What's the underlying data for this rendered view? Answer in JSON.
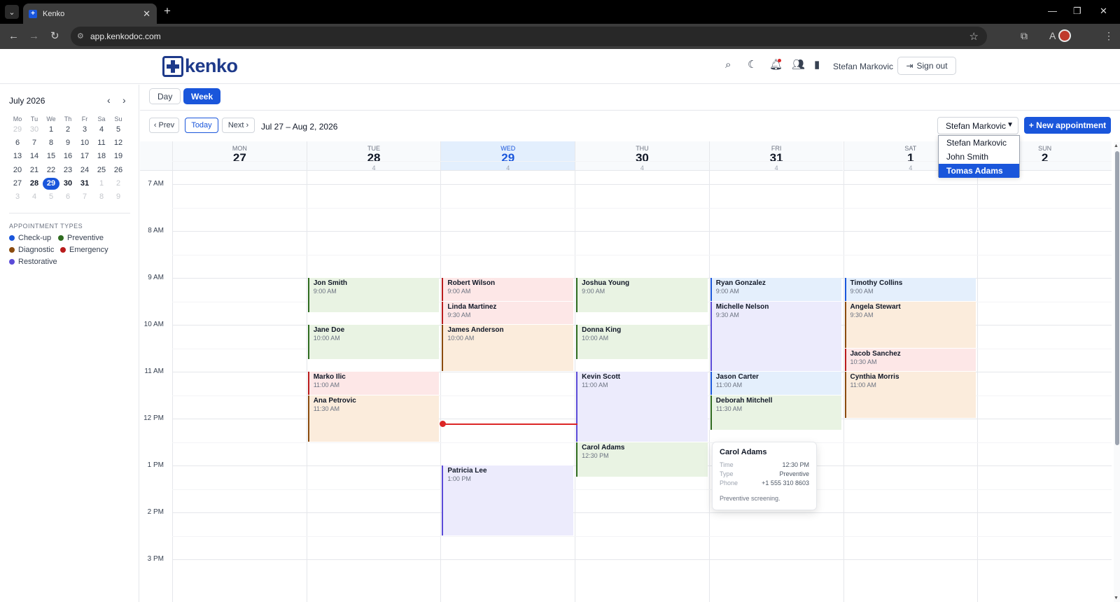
{
  "browser": {
    "tab_title": "Kenko",
    "url": "app.kenkodoc.com"
  },
  "header": {
    "logo_text": "kenko",
    "user_name": "Stefan Markovic",
    "sign_out_label": "Sign out"
  },
  "view_toggle": {
    "day_label": "Day",
    "week_label": "Week",
    "active": "Week"
  },
  "week_nav": {
    "prev_label": "‹ Prev",
    "today_label": "Today",
    "next_label": "Next ›",
    "range": "Jul 27 – Aug 2, 2026"
  },
  "provider": {
    "selected": "Stefan Markovic",
    "options": [
      "Stefan Markovic",
      "John Smith",
      "Tomas Adams"
    ],
    "highlighted": "Tomas Adams"
  },
  "new_appointment_label": "+ New appointment",
  "mini_calendar": {
    "month": "July 2026",
    "dow": [
      "Mo",
      "Tu",
      "We",
      "Th",
      "Fr",
      "Sa",
      "Su"
    ],
    "weeks": [
      [
        "29",
        "30",
        "1",
        "2",
        "3",
        "4",
        "5"
      ],
      [
        "6",
        "7",
        "8",
        "9",
        "10",
        "11",
        "12"
      ],
      [
        "13",
        "14",
        "15",
        "16",
        "17",
        "18",
        "19"
      ],
      [
        "20",
        "21",
        "22",
        "23",
        "24",
        "25",
        "26"
      ],
      [
        "27",
        "28",
        "29",
        "30",
        "31",
        "1",
        "2"
      ],
      [
        "3",
        "4",
        "5",
        "6",
        "7",
        "8",
        "9"
      ]
    ]
  },
  "appointment_types": {
    "heading": "APPOINTMENT TYPES",
    "items": [
      {
        "label": "Check-up",
        "color": "#1a56db"
      },
      {
        "label": "Preventive",
        "color": "#2e6b1f"
      },
      {
        "label": "Diagnostic",
        "color": "#8a4b0e"
      },
      {
        "label": "Emergency",
        "color": "#b91c1c"
      },
      {
        "label": "Restorative",
        "color": "#5b4bd8"
      }
    ]
  },
  "days": [
    {
      "dow": "MON",
      "date": "27",
      "count": ""
    },
    {
      "dow": "TUE",
      "date": "28",
      "count": "4"
    },
    {
      "dow": "WED",
      "date": "29",
      "count": "4"
    },
    {
      "dow": "THU",
      "date": "30",
      "count": "4"
    },
    {
      "dow": "FRI",
      "date": "31",
      "count": "4"
    },
    {
      "dow": "SAT",
      "date": "1",
      "count": "4"
    },
    {
      "dow": "SUN",
      "date": "2",
      "count": ""
    }
  ],
  "hours": [
    "7 AM",
    "8 AM",
    "9 AM",
    "10 AM",
    "11 AM",
    "12 PM",
    "1 PM",
    "2 PM",
    "3 PM"
  ],
  "appointments": [
    {
      "day": 1,
      "name": "Jon Smith",
      "time": "9:00 AM",
      "type": "preventive"
    },
    {
      "day": 1,
      "name": "Jane Doe",
      "time": "10:00 AM",
      "type": "preventive"
    },
    {
      "day": 1,
      "name": "Marko Ilic",
      "time": "11:00 AM",
      "type": "emergency"
    },
    {
      "day": 1,
      "name": "Ana Petrovic",
      "time": "11:30 AM",
      "type": "diagnostic"
    },
    {
      "day": 2,
      "name": "Robert Wilson",
      "time": "9:00 AM",
      "type": "emergency"
    },
    {
      "day": 2,
      "name": "Linda Martinez",
      "time": "9:30 AM",
      "type": "emergency"
    },
    {
      "day": 2,
      "name": "James Anderson",
      "time": "10:00 AM",
      "type": "diagnostic"
    },
    {
      "day": 2,
      "name": "Patricia Lee",
      "time": "1:00 PM",
      "type": "restorative"
    },
    {
      "day": 3,
      "name": "Joshua Young",
      "time": "9:00 AM",
      "type": "preventive"
    },
    {
      "day": 3,
      "name": "Donna King",
      "time": "10:00 AM",
      "type": "preventive"
    },
    {
      "day": 3,
      "name": "Kevin Scott",
      "time": "11:00 AM",
      "type": "restorative"
    },
    {
      "day": 3,
      "name": "Carol Adams",
      "time": "12:30 PM",
      "type": "preventive"
    },
    {
      "day": 4,
      "name": "Ryan Gonzalez",
      "time": "9:00 AM",
      "type": "checkup"
    },
    {
      "day": 4,
      "name": "Michelle Nelson",
      "time": "9:30 AM",
      "type": "restorative"
    },
    {
      "day": 4,
      "name": "Jason Carter",
      "time": "11:00 AM",
      "type": "checkup"
    },
    {
      "day": 4,
      "name": "Deborah Mitchell",
      "time": "11:30 AM",
      "type": "preventive"
    },
    {
      "day": 5,
      "name": "Timothy Collins",
      "time": "9:00 AM",
      "type": "checkup"
    },
    {
      "day": 5,
      "name": "Angela Stewart",
      "time": "9:30 AM",
      "type": "diagnostic"
    },
    {
      "day": 5,
      "name": "Jacob Sanchez",
      "time": "10:30 AM",
      "type": "emergency"
    },
    {
      "day": 5,
      "name": "Cynthia Morris",
      "time": "11:00 AM",
      "type": "diagnostic"
    }
  ],
  "tooltip": {
    "name": "Carol Adams",
    "time_label": "Time",
    "time": "12:30 PM",
    "type_label": "Type",
    "type": "Preventive",
    "phone_label": "Phone",
    "phone": "+1 555 310 8603",
    "note": "Preventive screening."
  }
}
